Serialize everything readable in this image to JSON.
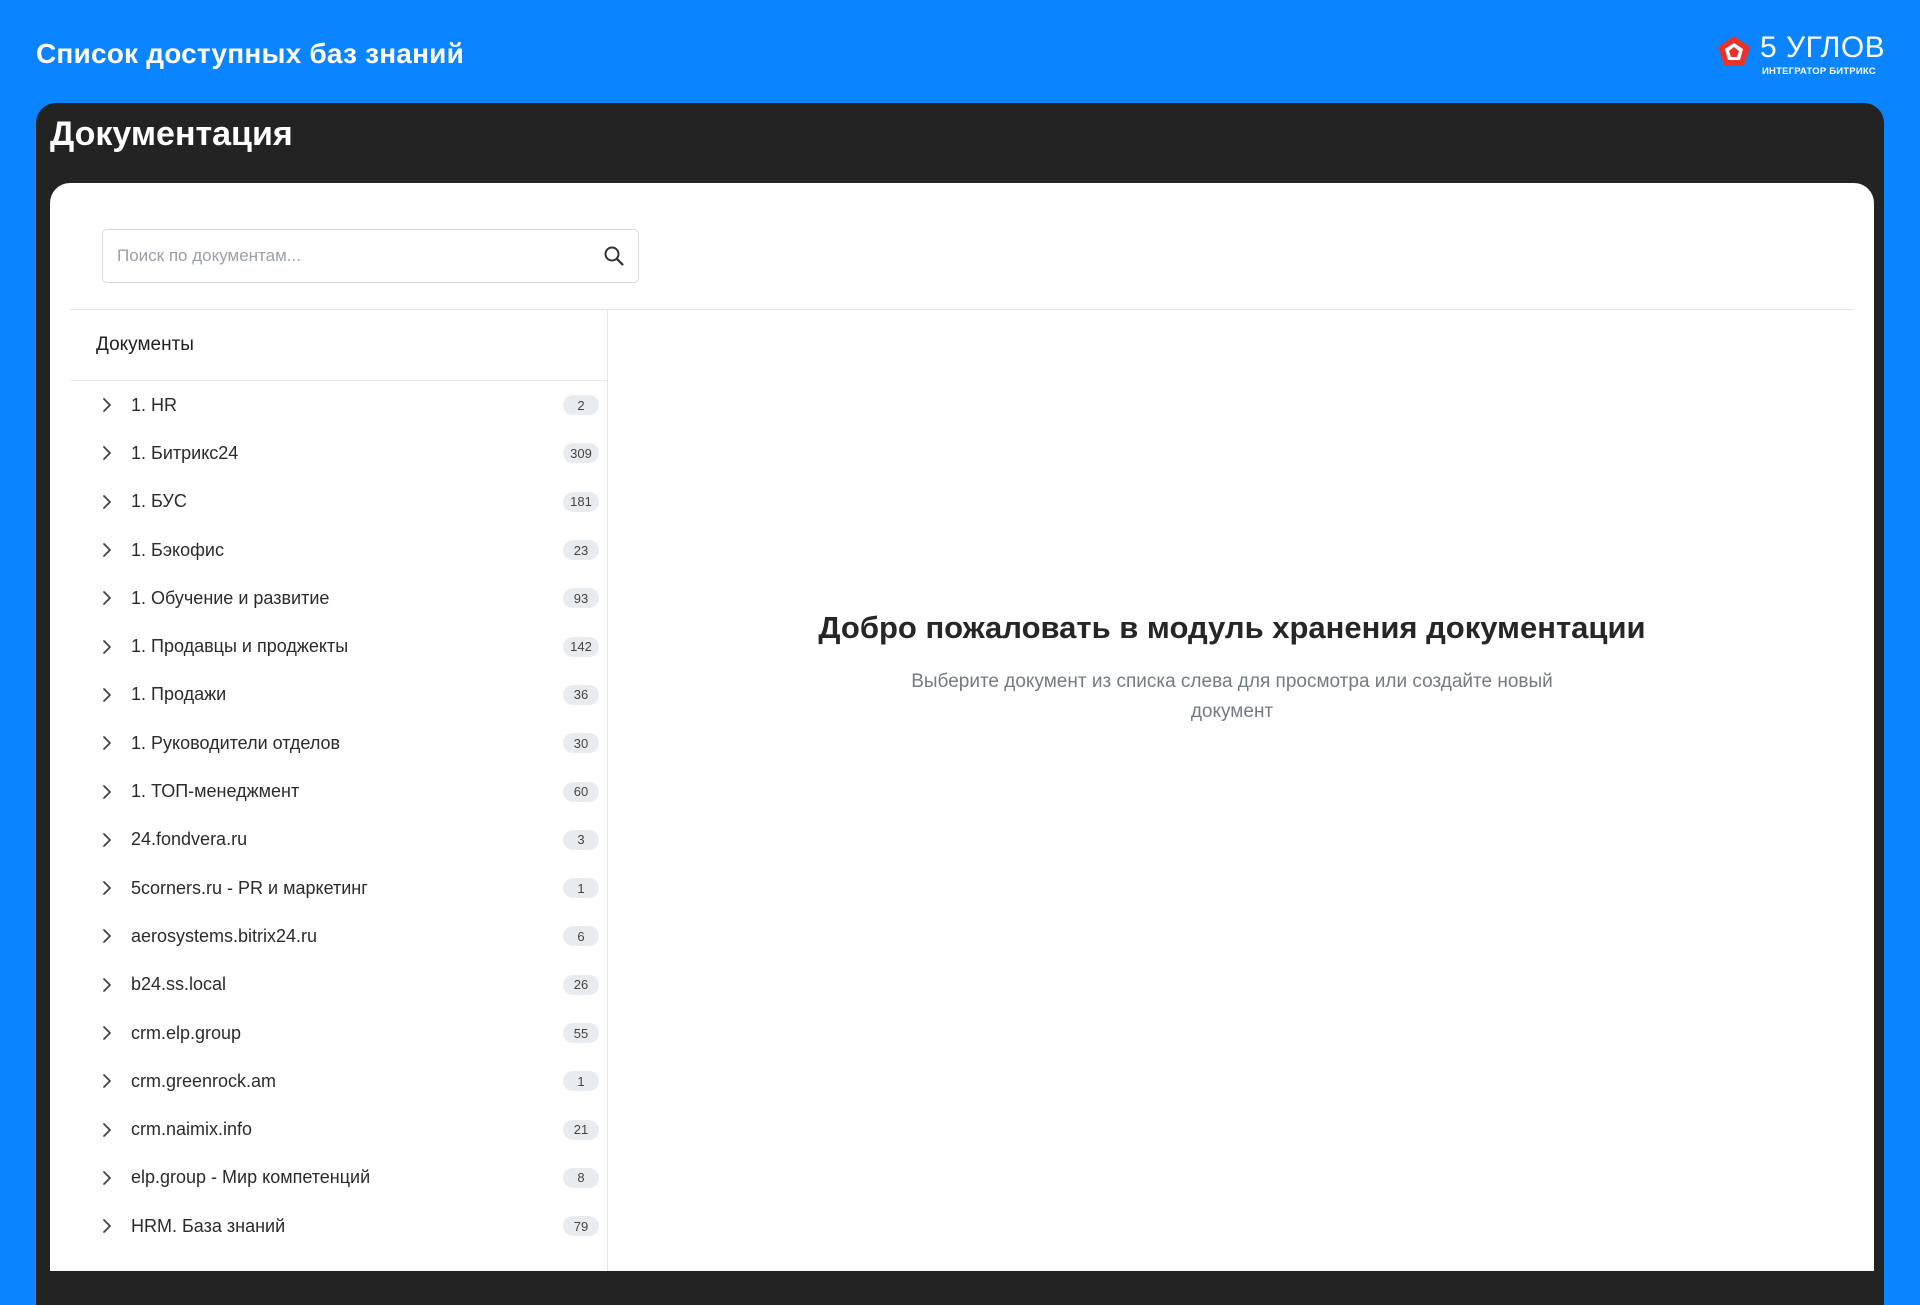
{
  "header": {
    "app_title": "Список доступных баз знаний",
    "logo": {
      "name": "5 УГЛОВ",
      "subtitle": "ИНТЕГРАТОР БИТРИКС",
      "icon": "pentagon-logo-icon"
    }
  },
  "section": {
    "title": "Документация"
  },
  "search": {
    "placeholder": "Поиск по документам...",
    "value": "",
    "icon": "search-icon"
  },
  "sidebar": {
    "header": "Документы",
    "items": [
      {
        "label": "1. HR",
        "count": "2"
      },
      {
        "label": "1. Битрикс24",
        "count": "309"
      },
      {
        "label": "1. БУС",
        "count": "181"
      },
      {
        "label": "1. Бэкофис",
        "count": "23"
      },
      {
        "label": "1. Обучение и развитие",
        "count": "93"
      },
      {
        "label": "1. Продавцы и проджекты",
        "count": "142"
      },
      {
        "label": "1. Продажи",
        "count": "36"
      },
      {
        "label": "1. Руководители отделов",
        "count": "30"
      },
      {
        "label": "1. ТОП-менеджмент",
        "count": "60"
      },
      {
        "label": "24.fondvera.ru",
        "count": "3"
      },
      {
        "label": "5corners.ru - PR и маркетинг",
        "count": "1"
      },
      {
        "label": "aerosystems.bitrix24.ru",
        "count": "6"
      },
      {
        "label": "b24.ss.local",
        "count": "26"
      },
      {
        "label": "crm.elp.group",
        "count": "55"
      },
      {
        "label": "crm.greenrock.am",
        "count": "1"
      },
      {
        "label": "crm.naimix.info",
        "count": "21"
      },
      {
        "label": "elp.group - Мир компетенций",
        "count": "8"
      },
      {
        "label": "HRM. База знаний",
        "count": "79"
      }
    ]
  },
  "welcome": {
    "title": "Добро пожаловать в модуль хранения документации",
    "subtitle_line1": "Выберите документ из списка слева для просмотра или создайте новый",
    "subtitle_line2": "документ"
  },
  "colors": {
    "brand_blue": "#0a84ff",
    "panel_dark": "#232323",
    "logo_red": "#e8332a"
  }
}
